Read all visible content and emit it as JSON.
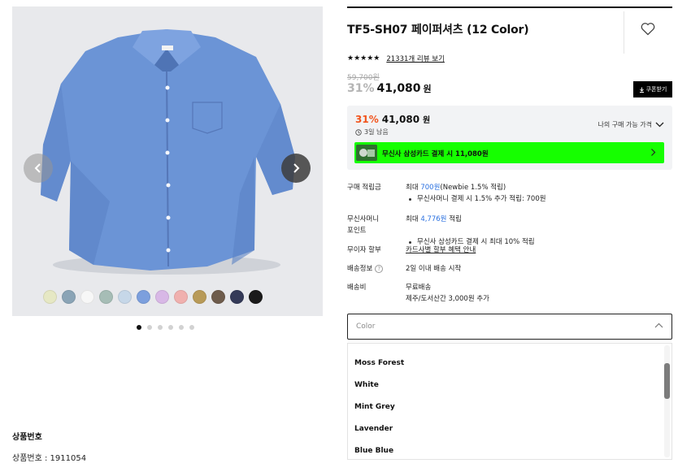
{
  "gallery": {
    "shirt_color": "#6b94d6",
    "swatches": [
      "#e6e8c4",
      "#8aa4b6",
      "#f7f7f7",
      "#a6bdb6",
      "#c6d7e8",
      "#7c9fdd",
      "#d8b8e6",
      "#f0b0ae",
      "#b89a58",
      "#6e5c4c",
      "#343a58",
      "#1a1a1a"
    ],
    "dots_total": 6,
    "dots_active_index": 0
  },
  "product_info": {
    "title": "상품번호",
    "number": "상품번호 : 1911054"
  },
  "product": {
    "title": "TF5-SH07 페이퍼셔츠 (12 Color)",
    "stars": "★★★★★",
    "reviews": "21331개 리뷰 보기",
    "original_price": "59,700원",
    "discount": "31%",
    "price": "41,080",
    "price_unit": "원",
    "coupon": "쿠폰받기"
  },
  "best_price": {
    "discount": "31%",
    "price": "41,080",
    "unit": "원",
    "time_left": "3일 남음",
    "my_price": "나의 구매 가능 가격",
    "banner": "무신사 삼성카드 결제 시 11,080원"
  },
  "info": {
    "points_label": "구매 적립금",
    "points_prefix": "최대 ",
    "points_amount": "700원",
    "points_suffix": "(Newbie 1.5% 적립)",
    "points_bullet": "무신사머니 결제 시 1.5% 추가 적립: 700원",
    "money_label_1": "무신사머니",
    "money_label_2": "포인트",
    "money_prefix": "최대 ",
    "money_amount": "4,776원",
    "money_suffix": " 적립",
    "money_bullet": "무신사 삼성카드 결제 시 최대 10% 적립",
    "installment_label": "무이자 할부",
    "installment_value": "카드사별 할부 혜택 안내",
    "delivery_label": "배송정보",
    "delivery_value": "2일 이내 배송 시작",
    "fee_label": "배송비",
    "fee_value": "무료배송",
    "fee_note": "제주/도서산간 3,000원 추가"
  },
  "color_select": {
    "placeholder": "Color",
    "options": [
      "Moss Forest",
      "White",
      "Mint Grey",
      "Lavender",
      "Blue Blue"
    ]
  }
}
